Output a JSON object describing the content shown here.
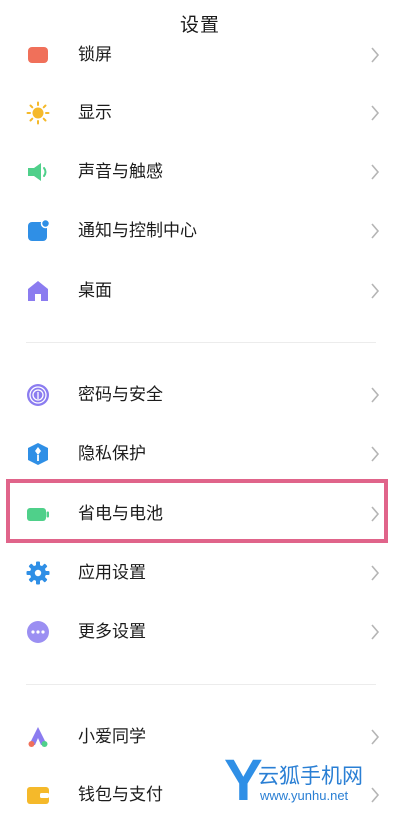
{
  "header": {
    "title": "设置"
  },
  "items": [
    {
      "label": "锁屏",
      "icon": "lock-screen-icon"
    },
    {
      "label": "显示",
      "icon": "sun-icon"
    },
    {
      "label": "声音与触感",
      "icon": "speaker-icon"
    },
    {
      "label": "通知与控制中心",
      "icon": "notification-icon"
    },
    {
      "label": "桌面",
      "icon": "home-icon"
    },
    {
      "label": "密码与安全",
      "icon": "fingerprint-icon"
    },
    {
      "label": "隐私保护",
      "icon": "privacy-shield-icon"
    },
    {
      "label": "省电与电池",
      "icon": "battery-icon"
    },
    {
      "label": "应用设置",
      "icon": "app-settings-gear-icon"
    },
    {
      "label": "更多设置",
      "icon": "more-dots-icon"
    },
    {
      "label": "小爱同学",
      "icon": "xiaoai-assistant-icon"
    },
    {
      "label": "钱包与支付",
      "icon": "wallet-icon"
    }
  ],
  "highlighted_item": "省电与电池",
  "colors": {
    "highlight_border": "#e0648a",
    "icon_red": "#f0705a",
    "icon_yellow": "#f5b92a",
    "icon_green": "#4fd08a",
    "icon_blue": "#2f8fe6",
    "icon_purple": "#8b7cf0",
    "watermark_blue": "#2a7fd4"
  },
  "watermark": {
    "logo_letter": "Y",
    "name": "云狐手机网",
    "url": "www.yunhu.net"
  }
}
